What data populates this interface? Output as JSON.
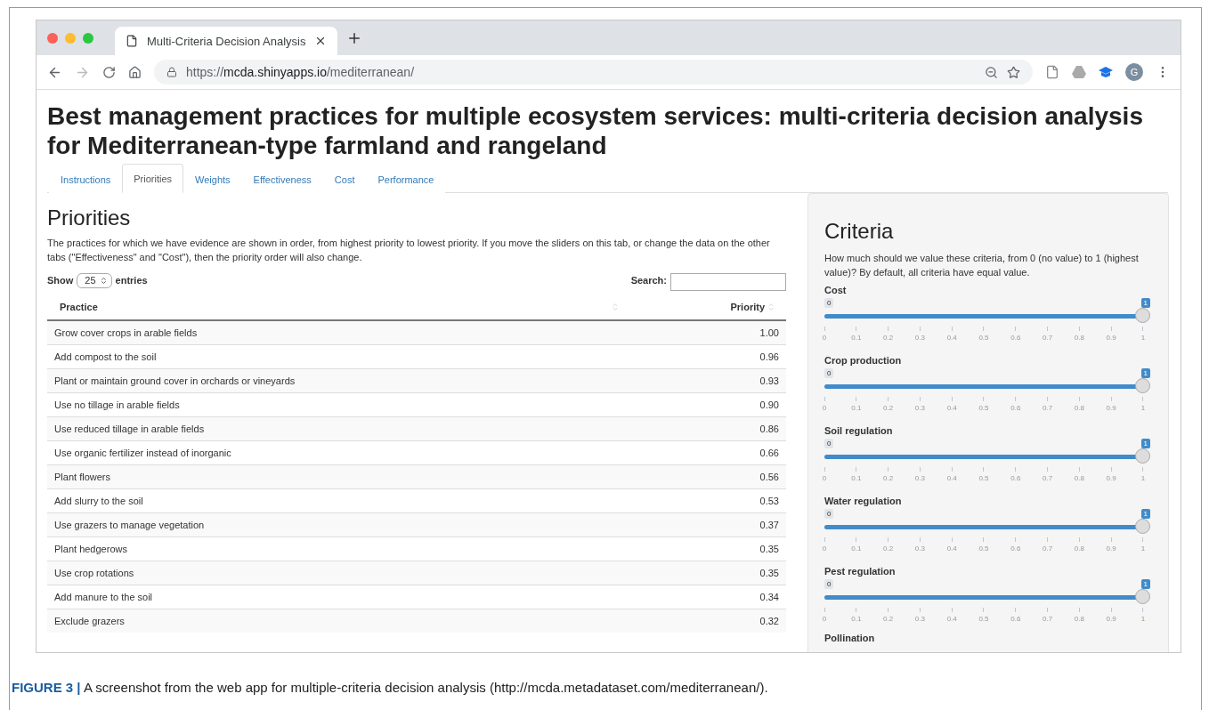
{
  "browser": {
    "tab": {
      "title": "Multi-Criteria Decision Analysis"
    },
    "url": {
      "host_prefix": "https://",
      "host": "mcda.shinyapps.io",
      "path": "/mediterranean/"
    },
    "profile_initial": "G"
  },
  "page": {
    "title": "Best management practices for multiple ecosystem services: multi-criteria decision analysis for Mediterranean-type farmland and rangeland",
    "tabs": [
      {
        "label": "Instructions",
        "selected": false
      },
      {
        "label": "Priorities",
        "selected": true
      },
      {
        "label": "Weights",
        "selected": false
      },
      {
        "label": "Effectiveness",
        "selected": false
      },
      {
        "label": "Cost",
        "selected": false
      },
      {
        "label": "Performance",
        "selected": false
      }
    ],
    "priorities": {
      "heading": "Priorities",
      "description": "The practices for which we have evidence are shown in order, from highest priority to lowest priority. If you move the sliders on this tab, or change the data on the other tabs (\"Effectiveness\" and \"Cost\"), then the priority order will also change.",
      "show_label": "Show",
      "page_size": "25",
      "entries_label": "entries",
      "search_label": "Search:",
      "table": {
        "columns": [
          "Practice",
          "Priority"
        ],
        "rows": [
          [
            "Grow cover crops in arable fields",
            "1.00"
          ],
          [
            "Add compost to the soil",
            "0.96"
          ],
          [
            "Plant or maintain ground cover in orchards or vineyards",
            "0.93"
          ],
          [
            "Use no tillage in arable fields",
            "0.90"
          ],
          [
            "Use reduced tillage in arable fields",
            "0.86"
          ],
          [
            "Use organic fertilizer instead of inorganic",
            "0.66"
          ],
          [
            "Plant flowers",
            "0.56"
          ],
          [
            "Add slurry to the soil",
            "0.53"
          ],
          [
            "Use grazers to manage vegetation",
            "0.37"
          ],
          [
            "Plant hedgerows",
            "0.35"
          ],
          [
            "Use crop rotations",
            "0.35"
          ],
          [
            "Add manure to the soil",
            "0.34"
          ],
          [
            "Exclude grazers",
            "0.32"
          ]
        ]
      }
    },
    "criteria": {
      "heading": "Criteria",
      "description": "How much should we value these criteria, from 0 (no value) to 1 (highest value)? By default, all criteria have equal value.",
      "sliders": [
        {
          "label": "Cost",
          "min_label": "0",
          "max_label": "1",
          "level": 1,
          "tick_labels": [
            "0",
            "0.1",
            "0.2",
            "0.3",
            "0.4",
            "0.5",
            "0.6",
            "0.7",
            "0.8",
            "0.9",
            "1"
          ]
        },
        {
          "label": "Crop production",
          "min_label": "0",
          "max_label": "1",
          "level": 1,
          "tick_labels": [
            "0",
            "0.1",
            "0.2",
            "0.3",
            "0.4",
            "0.5",
            "0.6",
            "0.7",
            "0.8",
            "0.9",
            "1"
          ]
        },
        {
          "label": "Soil regulation",
          "min_label": "0",
          "max_label": "1",
          "level": 1,
          "tick_labels": [
            "0",
            "0.1",
            "0.2",
            "0.3",
            "0.4",
            "0.5",
            "0.6",
            "0.7",
            "0.8",
            "0.9",
            "1"
          ]
        },
        {
          "label": "Water regulation",
          "min_label": "0",
          "max_label": "1",
          "level": 1,
          "tick_labels": [
            "0",
            "0.1",
            "0.2",
            "0.3",
            "0.4",
            "0.5",
            "0.6",
            "0.7",
            "0.8",
            "0.9",
            "1"
          ]
        },
        {
          "label": "Pest regulation",
          "min_label": "0",
          "max_label": "1",
          "level": 1,
          "tick_labels": [
            "0",
            "0.1",
            "0.2",
            "0.3",
            "0.4",
            "0.5",
            "0.6",
            "0.7",
            "0.8",
            "0.9",
            "1"
          ]
        }
      ],
      "cut_off_label": "Pollination"
    }
  },
  "caption": "**FIGURE 3 |** A screenshot from the web app for multiple-criteria decision analysis (http://mcda.metadataset.com/mediterranean/)."
}
